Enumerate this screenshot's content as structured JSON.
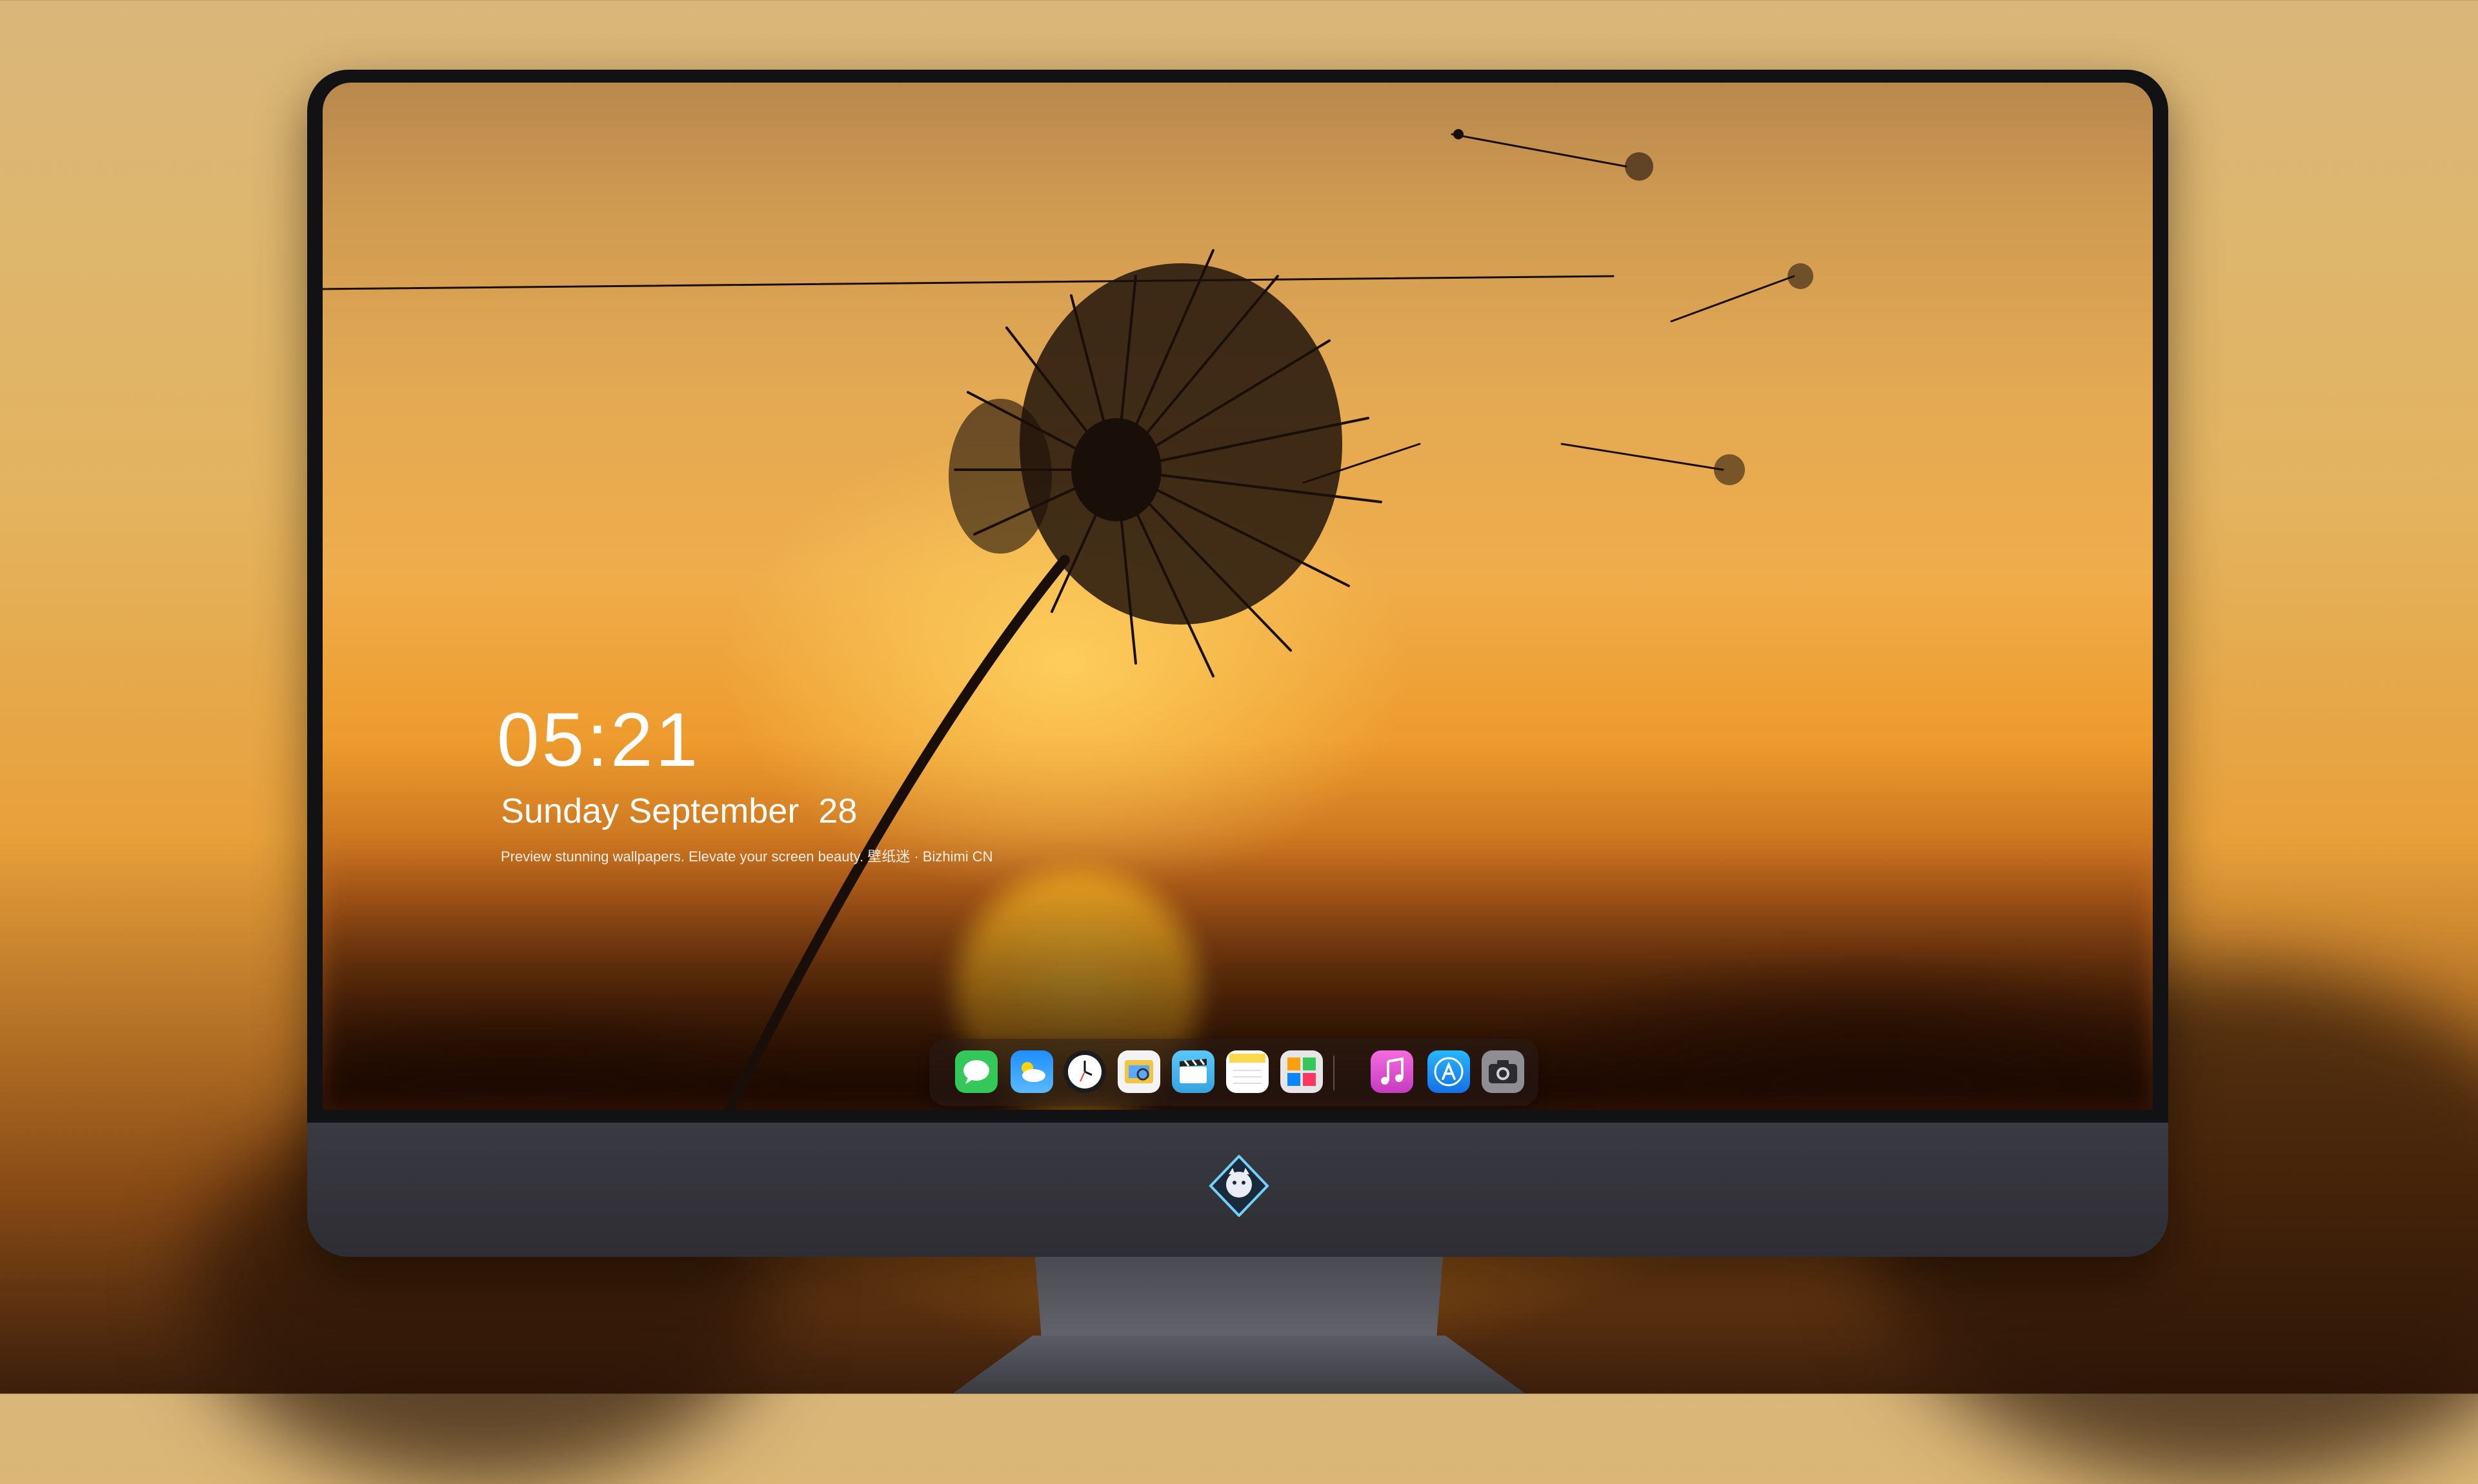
{
  "lock_screen": {
    "time": "05:21",
    "date": "Sunday September  28",
    "tagline": "Preview stunning wallpapers. Elevate your screen beauty. 壁纸迷 · Bizhimi CN"
  },
  "dock": {
    "apps": [
      {
        "name": "messages-icon",
        "color": "#34c759"
      },
      {
        "name": "weather-icon",
        "color": "#1e90ff"
      },
      {
        "name": "clock-icon",
        "color": "#1c1c1e"
      },
      {
        "name": "preview-icon",
        "color": "#f5c542"
      },
      {
        "name": "clips-icon",
        "color": "#5ac8fa"
      },
      {
        "name": "notes-icon",
        "color": "#ffd84d"
      },
      {
        "name": "photo-booth-icon",
        "color": "#e6e6e6"
      },
      {
        "name": "music-icon",
        "color": "#e64fbf"
      },
      {
        "name": "app-store-icon",
        "color": "#1a8cff"
      },
      {
        "name": "camera-icon",
        "color": "#8e8e93"
      }
    ]
  },
  "colors": {
    "sky_top": "#b8884d",
    "sky_mid": "#efad4b",
    "sun": "#ffc53a",
    "bezel": "#121214",
    "chin": "#3a3a42"
  }
}
